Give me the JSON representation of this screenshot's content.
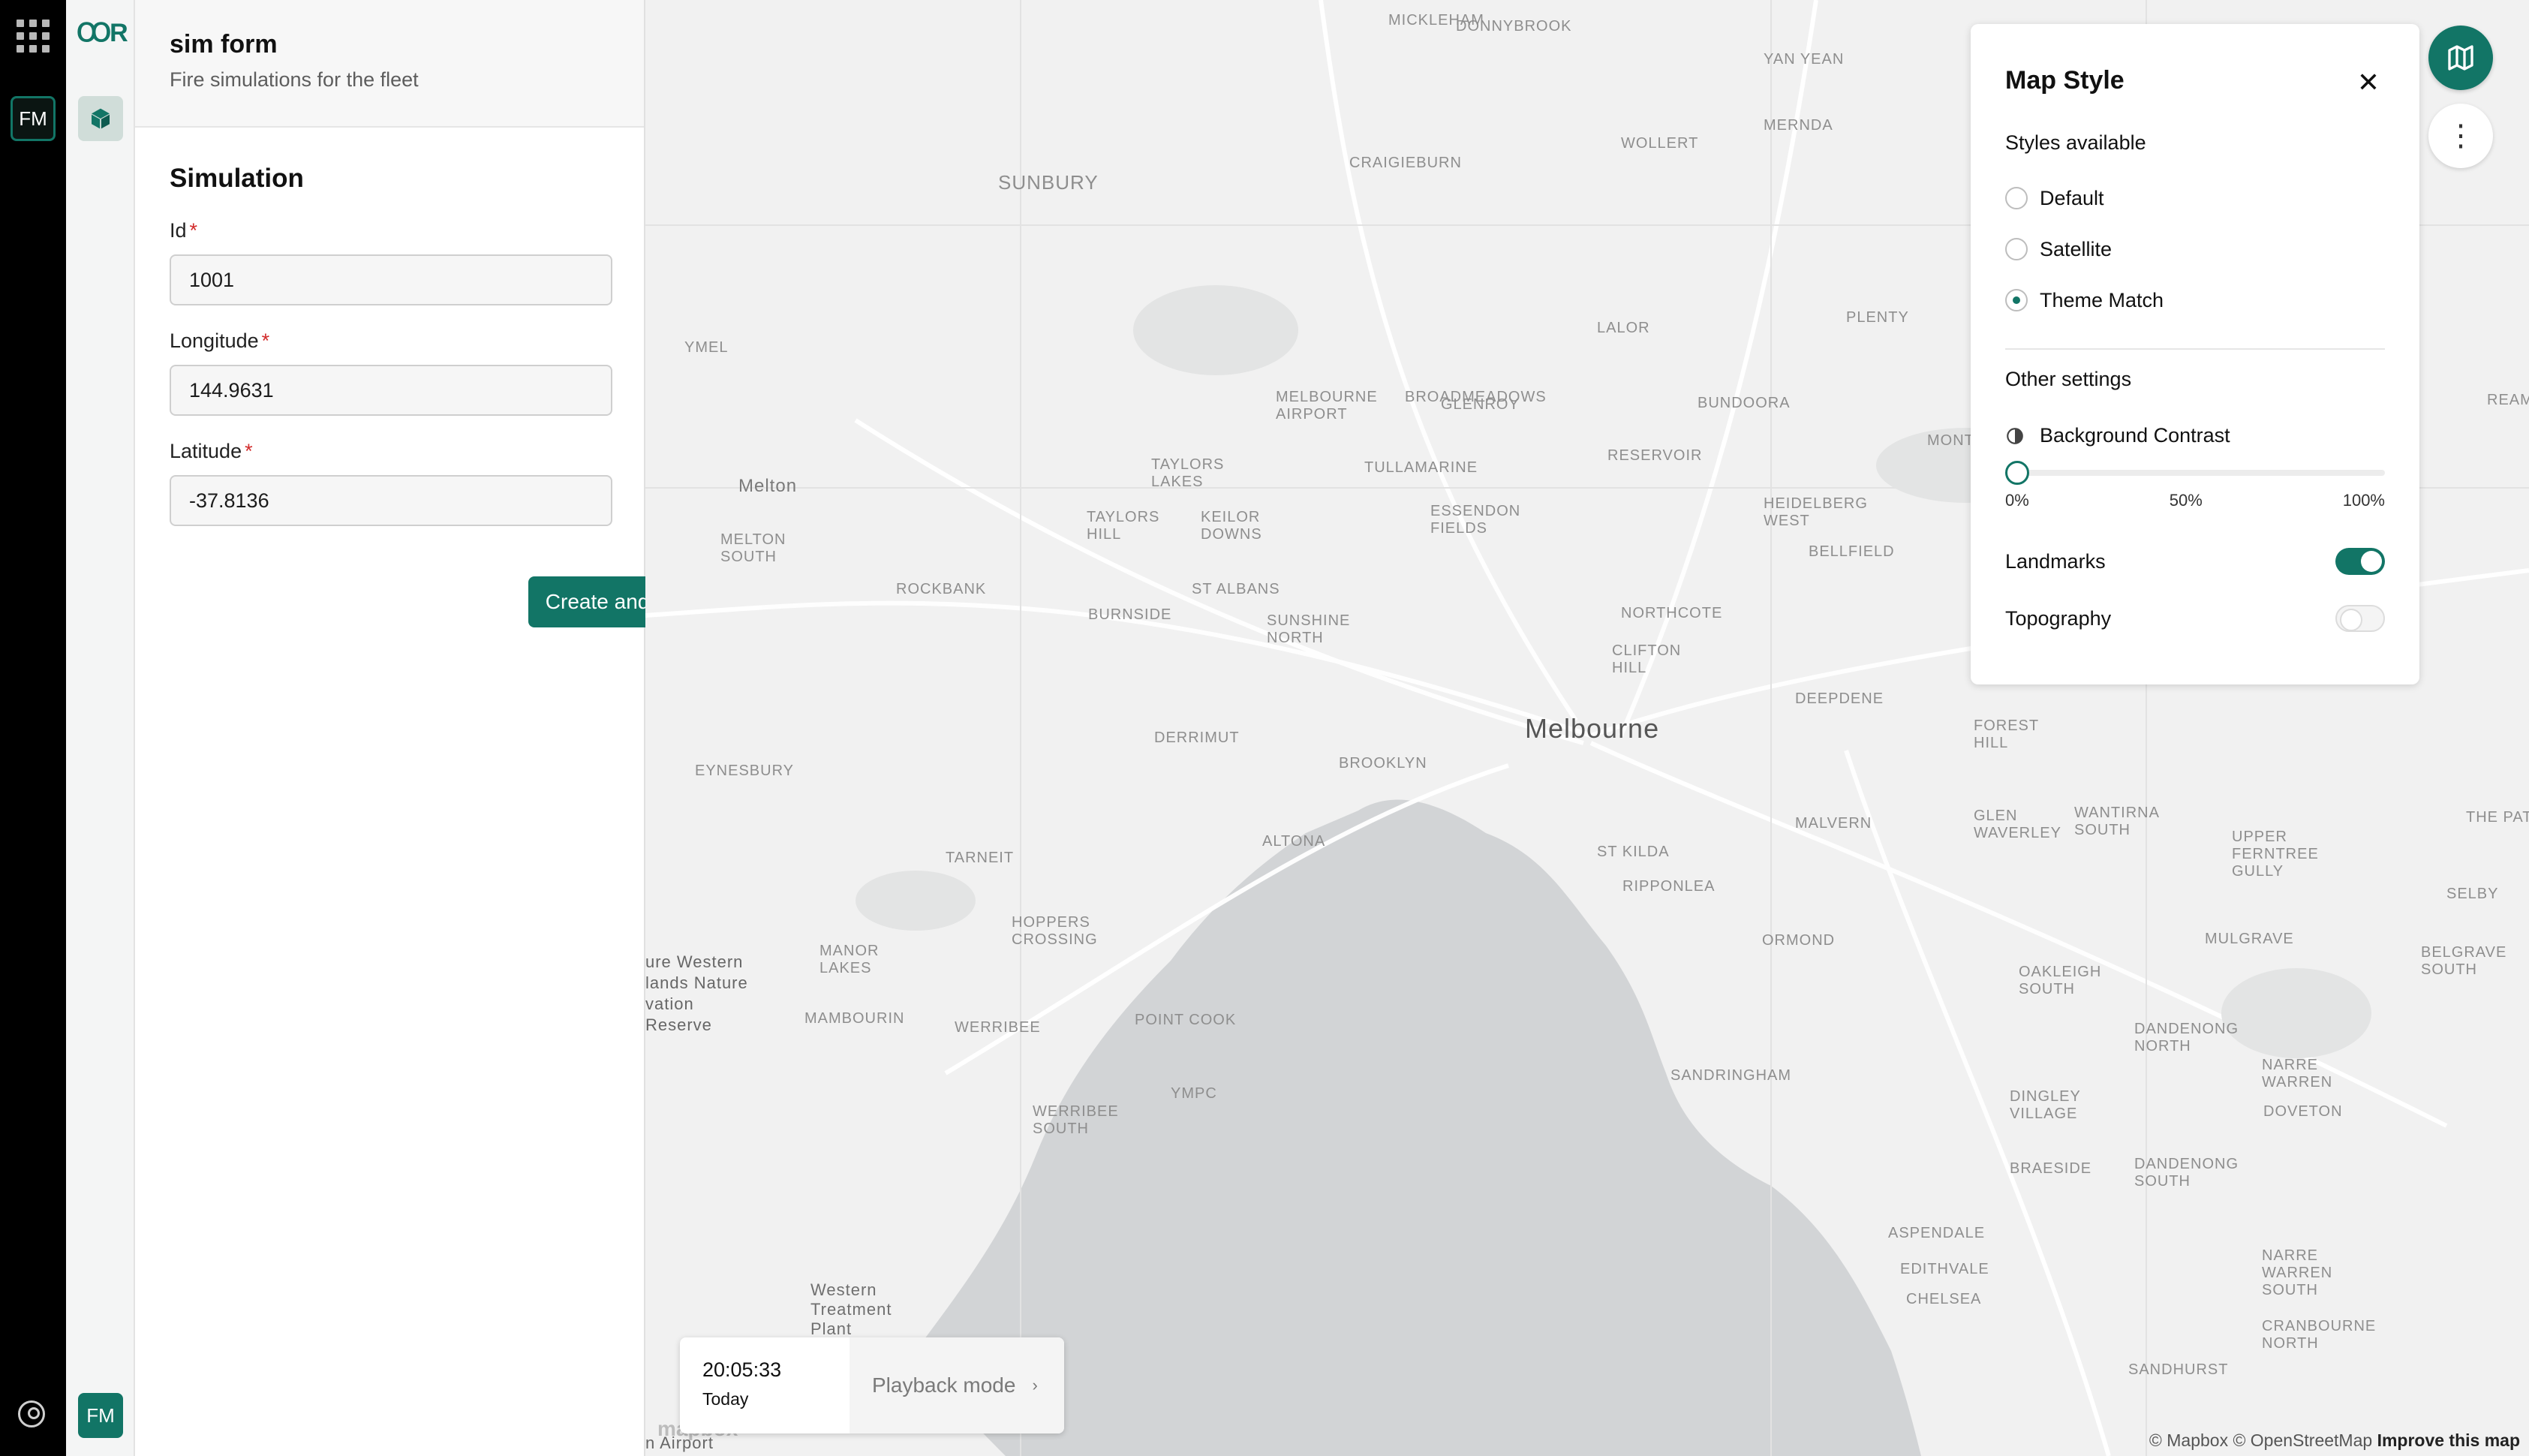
{
  "rail": {
    "user_initials": "FM"
  },
  "rail2": {
    "logo_text": "ꝎR",
    "bottom_initials": "FM"
  },
  "form_panel": {
    "title": "sim form",
    "subtitle": "Fire simulations for the fleet",
    "section_title": "Simulation",
    "fields": [
      {
        "label": "Id",
        "required_mark": "*",
        "value": "1001"
      },
      {
        "label": "Longitude",
        "required_mark": "*",
        "value": "144.9631"
      },
      {
        "label": "Latitude",
        "required_mark": "*",
        "value": "-37.8136"
      }
    ],
    "submit_label": "Create and execute"
  },
  "map": {
    "city_label": "Melbourne",
    "labels": [
      "MICKLEHAM",
      "DONNYBROOK",
      "YAN YEAN",
      "MERNDA",
      "WOLLERT",
      "CRAIGIEBURN",
      "SUNBURY",
      "PLENTY",
      "YMEL",
      "LALOR",
      "MELBOURNE AIRPORT",
      "BROADMEADOWS",
      "BUNDOORA",
      "GLENROY",
      "RESERVOIR",
      "MONTMORENCY",
      "Melton",
      "TAYLORS LAKES",
      "TULLAMARINE",
      "HEIDELBERG WEST",
      "MELTON SOUTH",
      "TAYLORS HILL",
      "KEILOR DOWNS",
      "ESSENDON FIELDS",
      "BELLFIELD",
      "ROCKBANK",
      "BURNSIDE",
      "ST ALBANS",
      "SUNSHINE NORTH",
      "NORTHCOTE",
      "CLIFTON HILL",
      "DEEPDENE",
      "FOREST HILL",
      "DERRIMUT",
      "BROOKLYN",
      "EYNESBURY",
      "MALVERN",
      "WANTIRNA SOUTH",
      "UPPER FERNTREE GULLY",
      "GLEN WAVERLEY",
      "ST KILDA",
      "RIPPONLEA",
      "TARNEIT",
      "ALTONA",
      "SELBY",
      "ORMOND",
      "HOPPERS CROSSING",
      "MANOR LAKES",
      "OAKLEIGH SOUTH",
      "MULGRAVE",
      "BELGRAVE SOUTH",
      "ure Western lands Nature vation Reserve",
      "MAMBOURIN",
      "WERRIBEE",
      "POINT COOK",
      "DANDENONG NORTH",
      "SANDRINGHAM",
      "NARRE WARREN",
      "DINGLEY VILLAGE",
      "DOVETON",
      "YMPC",
      "WERRIBEE SOUTH",
      "BRAESIDE",
      "DANDENONG SOUTH",
      "ASPENDALE",
      "NARRE WARREN SOUTH",
      "EDITHVALE",
      "CHELSEA",
      "Western Treatment Plant",
      "CRANBOURNE NORTH",
      "SANDHURST",
      "REAM",
      "THE PATCH",
      "n Airport"
    ],
    "mapbox_logo": "mapbox",
    "attribution": "© Mapbox © OpenStreetMap",
    "improve_link": "Improve this map"
  },
  "playback": {
    "time": "20:05:33",
    "day": "Today",
    "mode_label": "Playback mode",
    "chevron": "›"
  },
  "map_style": {
    "title": "Map Style",
    "close_glyph": "✕",
    "styles_heading": "Styles available",
    "options": [
      {
        "label": "Default",
        "selected": false
      },
      {
        "label": "Satellite",
        "selected": false
      },
      {
        "label": "Theme Match",
        "selected": true
      }
    ],
    "other_heading": "Other settings",
    "contrast": {
      "label": "Background Contrast",
      "value_percent": 0,
      "ticks": [
        "0%",
        "50%",
        "100%"
      ]
    },
    "landmarks": {
      "label": "Landmarks",
      "on": true
    },
    "topography": {
      "label": "Topography",
      "on": false
    }
  },
  "floating": {
    "more_glyph": "⋮"
  },
  "colors": {
    "accent": "#127566",
    "water": "#d2d4d6",
    "land": "#f1f1f1"
  }
}
